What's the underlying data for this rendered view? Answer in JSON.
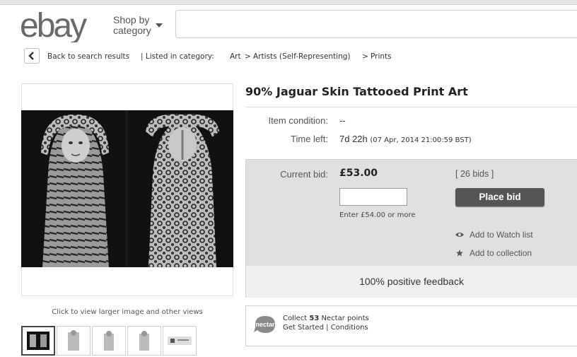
{
  "header": {
    "logo_text": "ebay",
    "shop_by_line1": "Shop by",
    "shop_by_line2": "category",
    "search_value": ""
  },
  "breadcrumb": {
    "back": "Back to search results",
    "listed": "| Listed in category:",
    "cat1": "Art",
    "sep1": ">",
    "cat2": "Artists (Self-Representing)",
    "sep2": ">",
    "cat3": "Prints"
  },
  "gallery": {
    "hint": "Click to view larger image and other views",
    "thumbnail_count": 5,
    "selected_index": 0
  },
  "item": {
    "title": "90% Jaguar Skin Tattooed Print Art",
    "condition_label": "Item condition:",
    "condition_value": "--",
    "time_left_label": "Time left:",
    "time_left_value": "7d 22h",
    "time_left_date": "(07 Apr, 2014  21:00:59 BST)"
  },
  "bid": {
    "current_label": "Current bid:",
    "current_value": "£53.00",
    "input_value": "",
    "enter_hint": "Enter £54.00 or more",
    "bids_count": "[ 26 bids ]",
    "place_bid": "Place bid",
    "watch": "Add to Watch list",
    "collection": "Add to collection",
    "feedback": "100% positive feedback"
  },
  "nectar": {
    "logo_text": "nectar",
    "collect_pre": "Collect",
    "points": "53",
    "collect_post": "Nectar points",
    "get_started": "Get Started",
    "divider": "|",
    "conditions": "Conditions"
  },
  "colors": {
    "button": "#555555",
    "panel": "#e0e0e0",
    "feedback_band": "#f0f0f0"
  }
}
